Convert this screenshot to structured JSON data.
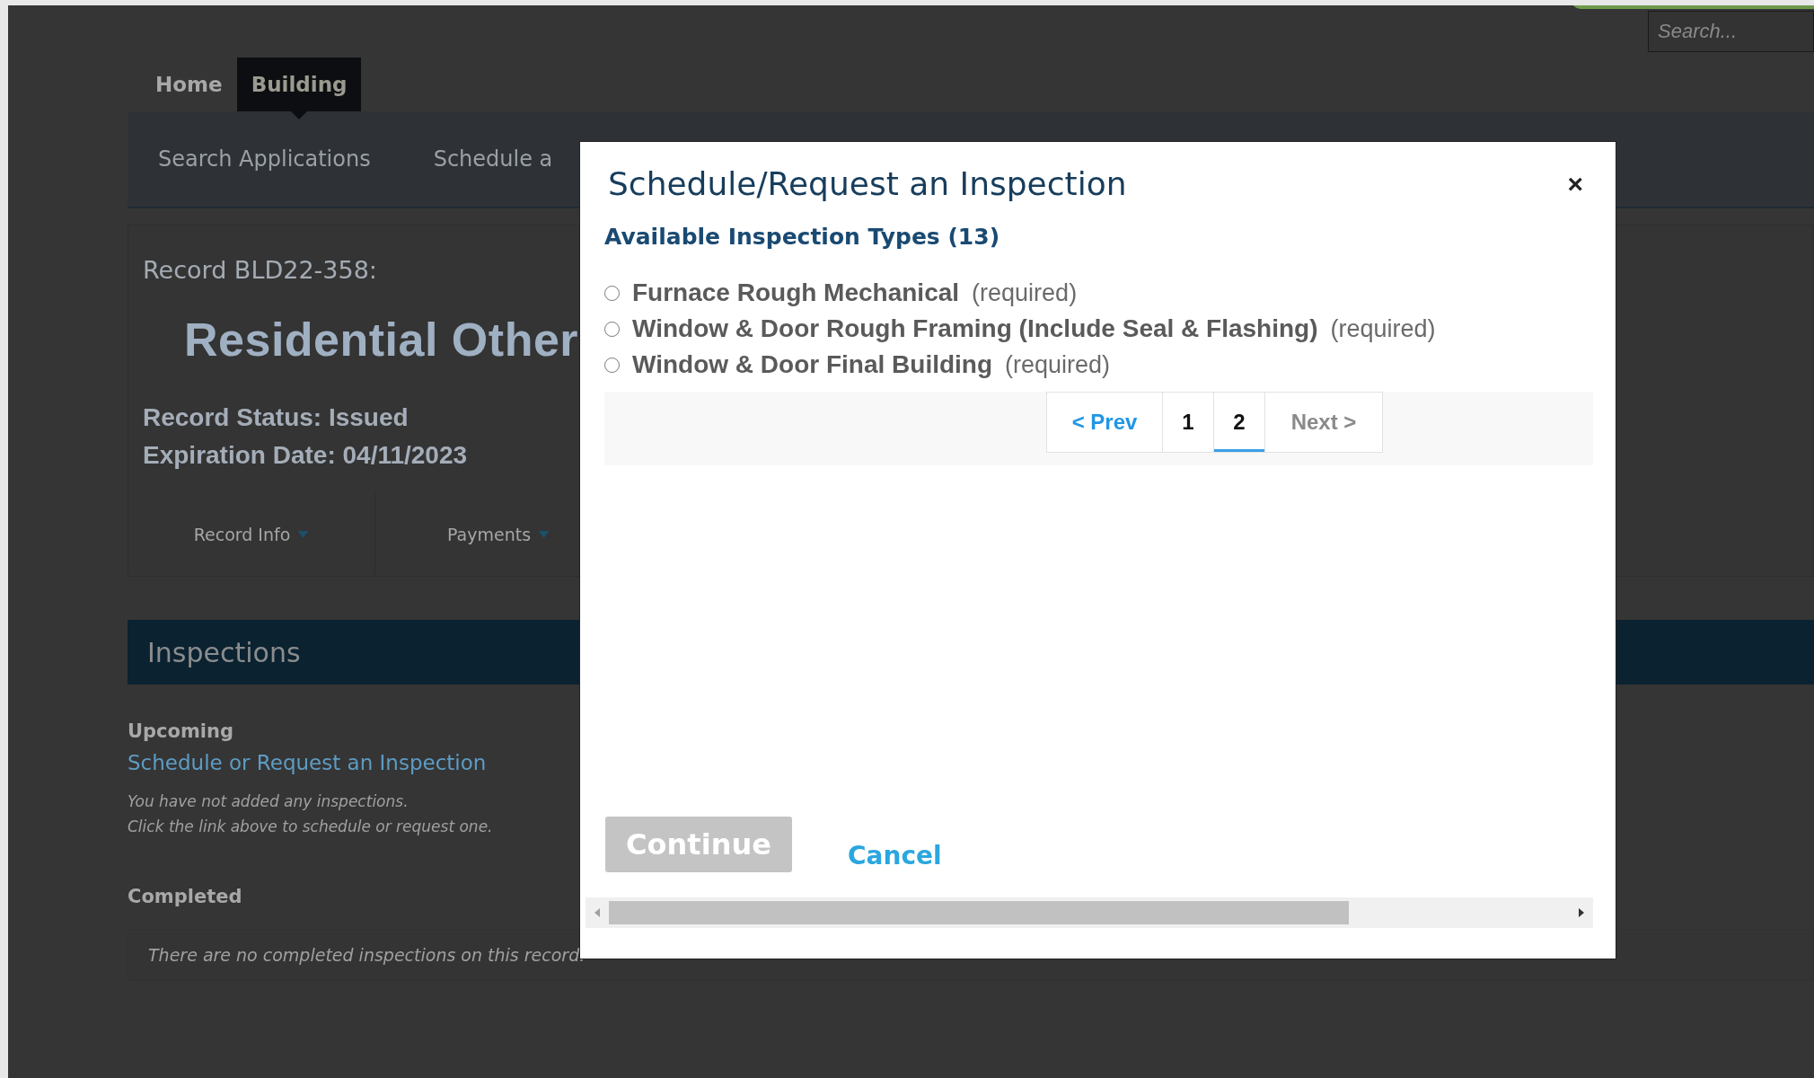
{
  "header": {
    "search": {
      "placeholder": "Search..."
    }
  },
  "nav": {
    "tabs": [
      {
        "label": "Home",
        "selected": false
      },
      {
        "label": "Building",
        "selected": true
      }
    ]
  },
  "subnav": {
    "items": [
      "Search Applications",
      "Schedule a"
    ]
  },
  "record": {
    "number": "Record BLD22-358:",
    "title": "Residential Other",
    "status": "Record Status: Issued",
    "expiration": "Expiration Date: 04/11/2023",
    "tabs": [
      {
        "label": "Record Info"
      },
      {
        "label": "Payments"
      }
    ]
  },
  "inspections": {
    "heading": "Inspections",
    "upcoming_label": "Upcoming",
    "schedule_link": "Schedule or Request an Inspection",
    "empty_notes": [
      "You have not added any inspections.",
      "Click the link above to schedule or request one."
    ],
    "completed_label": "Completed",
    "completed_empty": "There are no completed inspections on this record."
  },
  "modal": {
    "title": "Schedule/Request an Inspection",
    "close": "×",
    "section_title": "Available Inspection Types (13)",
    "options": [
      {
        "name": "Furnace Rough Mechanical",
        "note": "(required)",
        "selected": false
      },
      {
        "name": "Window & Door Rough Framing (Include Seal & Flashing)",
        "note": "(required)",
        "selected": false
      },
      {
        "name": "Window & Door Final Building",
        "note": "(required)",
        "selected": false
      }
    ],
    "pagination": {
      "prev": "< Prev",
      "pages": [
        {
          "label": "1",
          "selected": false
        },
        {
          "label": "2",
          "selected": true
        }
      ],
      "next": "Next >",
      "next_disabled": true
    },
    "continue": {
      "label": "Continue",
      "disabled": true
    },
    "cancel": "Cancel"
  }
}
